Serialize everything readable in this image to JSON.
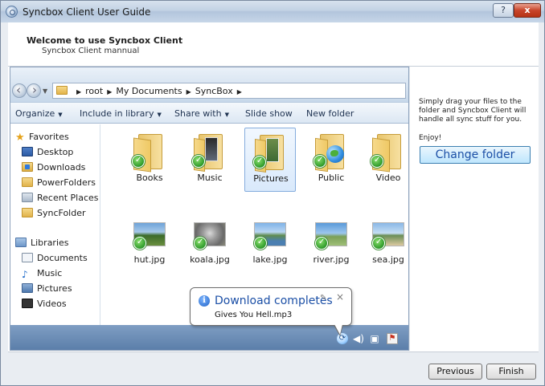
{
  "window": {
    "title": "Syncbox Client User Guide",
    "help_label": "?",
    "close_label": "x"
  },
  "header": {
    "title": "Welcome to use Syncbox Client",
    "subtitle": "Syncbox Client mannual"
  },
  "explorer": {
    "breadcrumb": [
      "root",
      "My Documents",
      "SyncBox"
    ],
    "toolbar": [
      {
        "label": "Organize",
        "has_caret": true
      },
      {
        "label": "Include in library",
        "has_caret": true
      },
      {
        "label": "Share with",
        "has_caret": true
      },
      {
        "label": "Slide show",
        "has_caret": false
      },
      {
        "label": "New folder",
        "has_caret": false
      }
    ],
    "nav": {
      "favorites": "Favorites",
      "desktop": "Desktop",
      "downloads": "Downloads",
      "powerfolders": "PowerFolders",
      "recent": "Recent Places",
      "syncfolder": "SyncFolder",
      "libraries": "Libraries",
      "documents": "Documents",
      "music": "Music",
      "pictures": "Pictures",
      "videos": "Videos"
    },
    "folders": {
      "books": "Books",
      "music": "Music",
      "pictures": "Pictures",
      "public": "Public",
      "video": "Video"
    },
    "files": {
      "hut": "hut.jpg",
      "koala": "koala.jpg",
      "lake": "lake.jpg",
      "river": "river.jpg",
      "sea": "sea.jpg"
    },
    "selected_item": "Pictures"
  },
  "balloon": {
    "title": "Download completes",
    "text": "Gives You Hell.mp3",
    "close_label": "×"
  },
  "right_panel": {
    "instructions": "Simply drag your files to the folder and Syncbox Client will handle all sync stuff for you.",
    "enjoy": "Enjoy!",
    "change_folder": "Change folder"
  },
  "footer": {
    "previous": "Previous",
    "finish": "Finish"
  },
  "colors": {
    "accent": "#1b4fa6",
    "check_green": "#2e9a2a",
    "status_strip": "#6a8db5"
  },
  "icons": [
    "app-icon",
    "folder-icon",
    "star-icon",
    "desktop-icon",
    "download-icon",
    "library-icon",
    "music-icon",
    "globe-icon",
    "check-icon",
    "info-icon",
    "pin-icon",
    "sync-icon",
    "volume-icon",
    "network-icon",
    "flag-icon"
  ]
}
